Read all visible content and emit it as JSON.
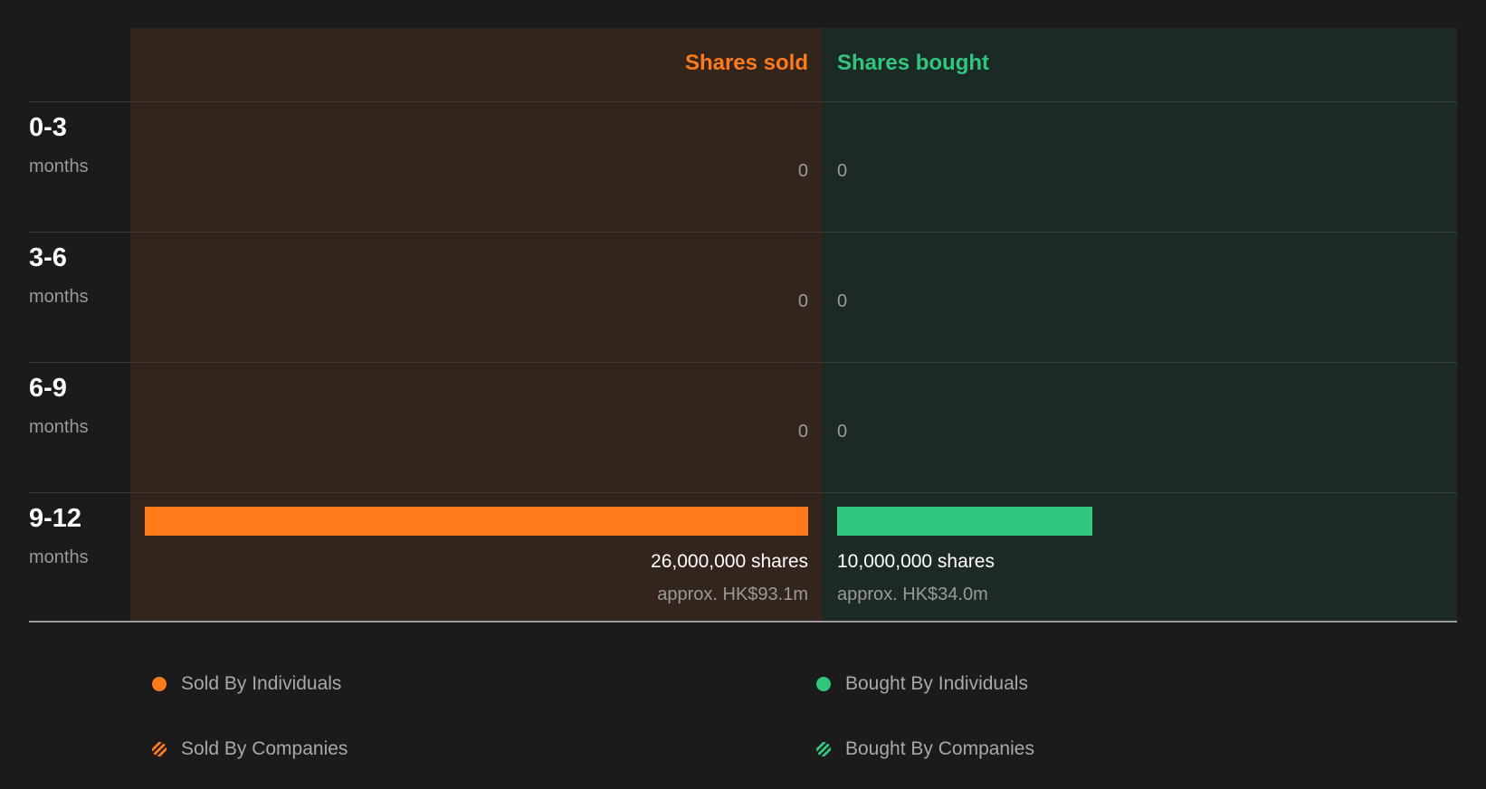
{
  "chart_data": {
    "type": "bar",
    "columns": {
      "sold": "Shares sold",
      "bought": "Shares bought"
    },
    "periods": [
      {
        "label": "0-3",
        "unit": "months",
        "sold": 0,
        "bought": 0,
        "sold_text": "0",
        "bought_text": "0"
      },
      {
        "label": "3-6",
        "unit": "months",
        "sold": 0,
        "bought": 0,
        "sold_text": "0",
        "bought_text": "0"
      },
      {
        "label": "6-9",
        "unit": "months",
        "sold": 0,
        "bought": 0,
        "sold_text": "0",
        "bought_text": "0"
      },
      {
        "label": "9-12",
        "unit": "months",
        "sold": 26000000,
        "bought": 10000000,
        "sold_text": "26,000,000 shares",
        "bought_text": "10,000,000 shares",
        "sold_approx": "approx. HK$93.1m",
        "bought_approx": "approx. HK$34.0m"
      }
    ],
    "legend": [
      {
        "label": "Sold By Individuals",
        "marker": "dot",
        "color": "#ff7a18"
      },
      {
        "label": "Bought By Individuals",
        "marker": "dot",
        "color": "#2fc77d"
      },
      {
        "label": "Sold By Companies",
        "marker": "hatched-dot",
        "color": "#ff7a18"
      },
      {
        "label": "Bought By Companies",
        "marker": "hatched-dot",
        "color": "#2fc77d"
      }
    ],
    "legend_placement": "bottom",
    "colors": {
      "sold": "#ff7a18",
      "bought": "#2fc77d"
    }
  }
}
